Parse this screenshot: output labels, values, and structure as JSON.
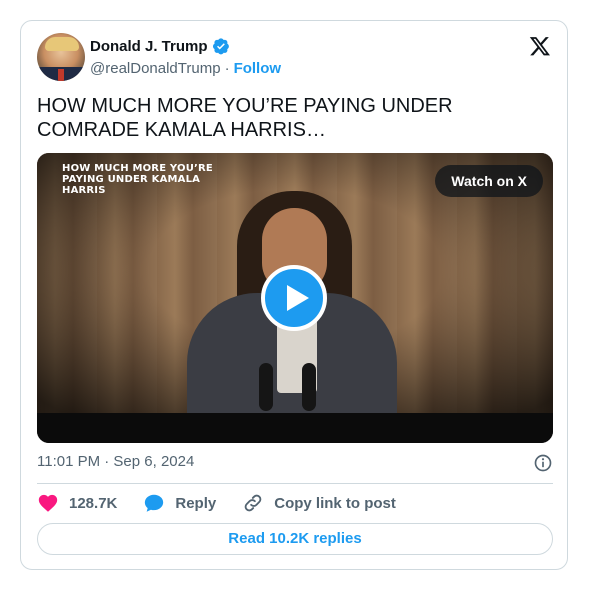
{
  "author": {
    "name": "Donald J. Trump",
    "handle": "@realDonaldTrump",
    "separator": "·",
    "follow_label": "Follow"
  },
  "tweet": {
    "text": "HOW MUCH MORE YOU’RE PAYING UNDER COMRADE KAMALA HARRIS…",
    "video_overlay_title": "HOW MUCH MORE YOU’RE PAYING UNDER KAMALA HARRIS",
    "watch_label": "Watch on X",
    "timestamp": "11:01 PM · Sep 6, 2024"
  },
  "actions": {
    "likes": "128.7K",
    "reply_label": "Reply",
    "copy_label": "Copy link to post"
  },
  "replies_button": "Read 10.2K replies",
  "colors": {
    "accent": "#1d9bf0",
    "like": "#f91880",
    "text": "#0f1419",
    "muted": "#536471",
    "border": "#cfd9de"
  },
  "icons": [
    "verified-badge-icon",
    "x-logo-icon",
    "play-icon",
    "info-icon",
    "heart-icon",
    "reply-bubble-icon",
    "link-icon"
  ]
}
